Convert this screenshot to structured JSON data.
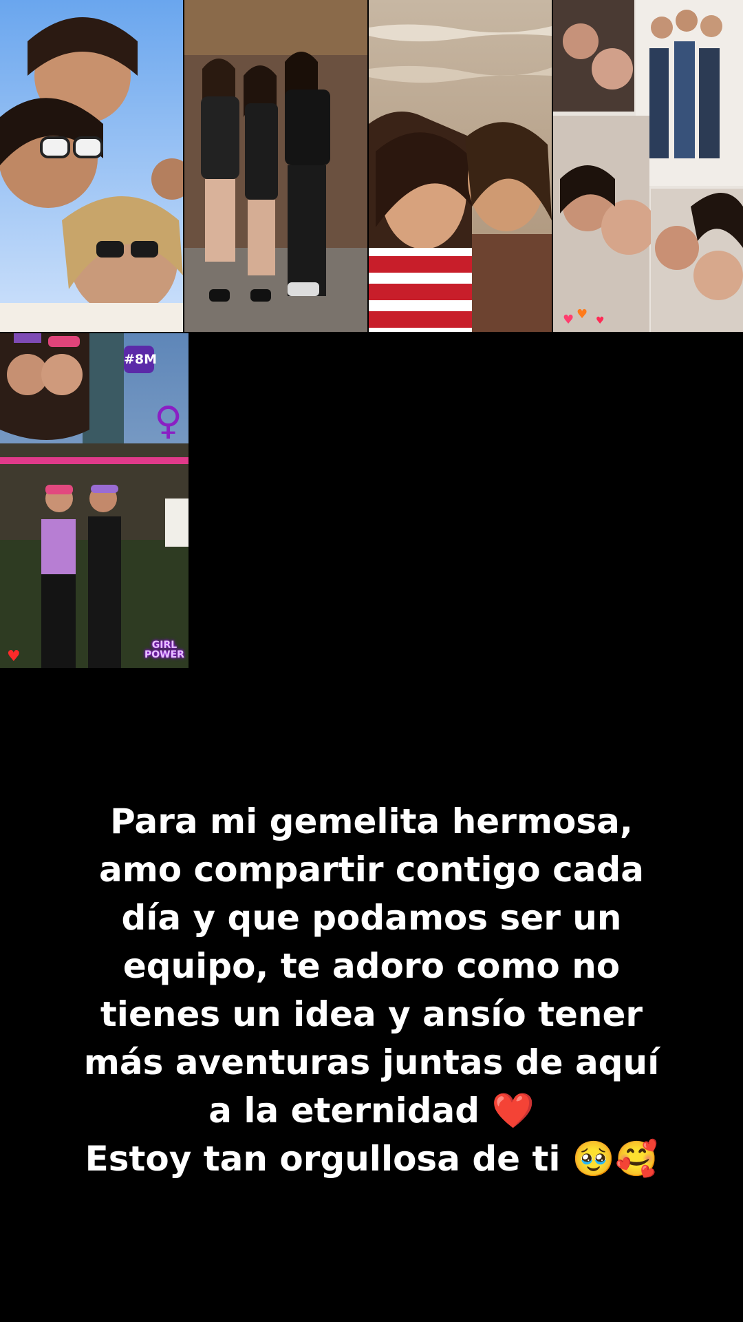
{
  "photos": [
    {
      "id": "selfie-sky",
      "subject": "group selfie against blue sky"
    },
    {
      "id": "mirror-trio",
      "subject": "three friends posing"
    },
    {
      "id": "beach-duo",
      "subject": "two friends laughing by the sea"
    },
    {
      "id": "collage-friends",
      "subject": "collage of friend selfies"
    },
    {
      "id": "march-8m",
      "subject": "two friends at march"
    }
  ],
  "overlays": {
    "badge": "#8M",
    "girl_power_line1": "GIRL",
    "girl_power_line2": "POWER",
    "venus_symbol": "♀"
  },
  "caption": {
    "lines": [
      "Para mi gemelita hermosa,",
      "amo compartir contigo cada",
      "día y que podamos ser un",
      "equipo, te adoro como no",
      "tienes un idea y ansío tener",
      "más aventuras juntas de aquí",
      "a la eternidad ❤️",
      "Estoy tan orgullosa de ti 🥹🥰"
    ]
  },
  "colors": {
    "background": "#000000",
    "caption_text": "#ffffff",
    "accent_purple": "#5b2aa8"
  }
}
